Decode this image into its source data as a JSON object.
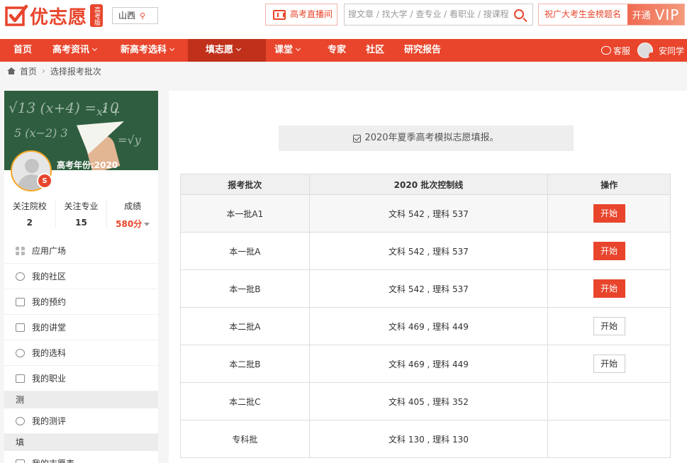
{
  "header": {
    "logo_text": "优志愿",
    "logo_badge": "高考版",
    "province": "山西",
    "live_label": "高考直播间",
    "search_placeholder": "搜文章 / 找大学 / 查专业 / 看职业 / 搜课程",
    "vip_slogan": "祝广大考生金榜题名",
    "vip_open": "开通",
    "vip_word": "VIP"
  },
  "nav": {
    "items": [
      {
        "label": "首页"
      },
      {
        "label": "高考资讯"
      },
      {
        "label": "新高考选科"
      },
      {
        "label": "填志愿"
      },
      {
        "label": "课堂"
      },
      {
        "label": "专家"
      },
      {
        "label": "社区"
      },
      {
        "label": "研究报告"
      }
    ],
    "service": "客服",
    "user": "安同学"
  },
  "breadcrumb": {
    "home": "首页",
    "current": "选择报考批次"
  },
  "sidebar": {
    "year_label": "高考年份:2020",
    "stats": [
      {
        "label": "关注院校",
        "value": "2"
      },
      {
        "label": "关注专业",
        "value": "15"
      },
      {
        "label": "成绩",
        "value": "580分"
      }
    ],
    "menu": [
      {
        "label": "应用广场",
        "icon": "grid-icon"
      },
      {
        "label": "我的社区",
        "icon": "chat-icon"
      },
      {
        "label": "我的预约",
        "icon": "graduation-cap-icon"
      },
      {
        "label": "我的讲堂",
        "icon": "video-icon"
      },
      {
        "label": "我的选科",
        "icon": "chat-icon"
      },
      {
        "label": "我的职业",
        "icon": "briefcase-icon"
      }
    ],
    "section_test": "测",
    "test_menu": [
      {
        "label": "我的测评",
        "icon": "target-icon"
      }
    ],
    "section_fill": "填",
    "fill_menu": [
      {
        "label": "我的志愿表",
        "icon": "table-icon"
      }
    ]
  },
  "main": {
    "notice": "2020年夏季高考模拟志愿填报。",
    "table": {
      "headers": [
        "报考批次",
        "2020 批次控制线",
        "操作"
      ],
      "rows": [
        {
          "batch": "本一批A1",
          "line": "文科 542 , 理科 537",
          "action": "开始",
          "style": "primary"
        },
        {
          "batch": "本一批A",
          "line": "文科 542 , 理科 537",
          "action": "开始",
          "style": "primary"
        },
        {
          "batch": "本一批B",
          "line": "文科 542 , 理科 537",
          "action": "开始",
          "style": "primary"
        },
        {
          "batch": "本二批A",
          "line": "文科 469 , 理科 449",
          "action": "开始",
          "style": "ghost"
        },
        {
          "batch": "本二批B",
          "line": "文科 469 , 理科 449",
          "action": "开始",
          "style": "ghost"
        },
        {
          "batch": "本二批C",
          "line": "文科 405 , 理科 352",
          "action": "",
          "style": "none"
        },
        {
          "batch": "专科批",
          "line": "文科 130 , 理科 130",
          "action": "",
          "style": "none"
        }
      ]
    }
  },
  "colors": {
    "brand": "#e8452c",
    "nav_active": "#c0301b"
  }
}
